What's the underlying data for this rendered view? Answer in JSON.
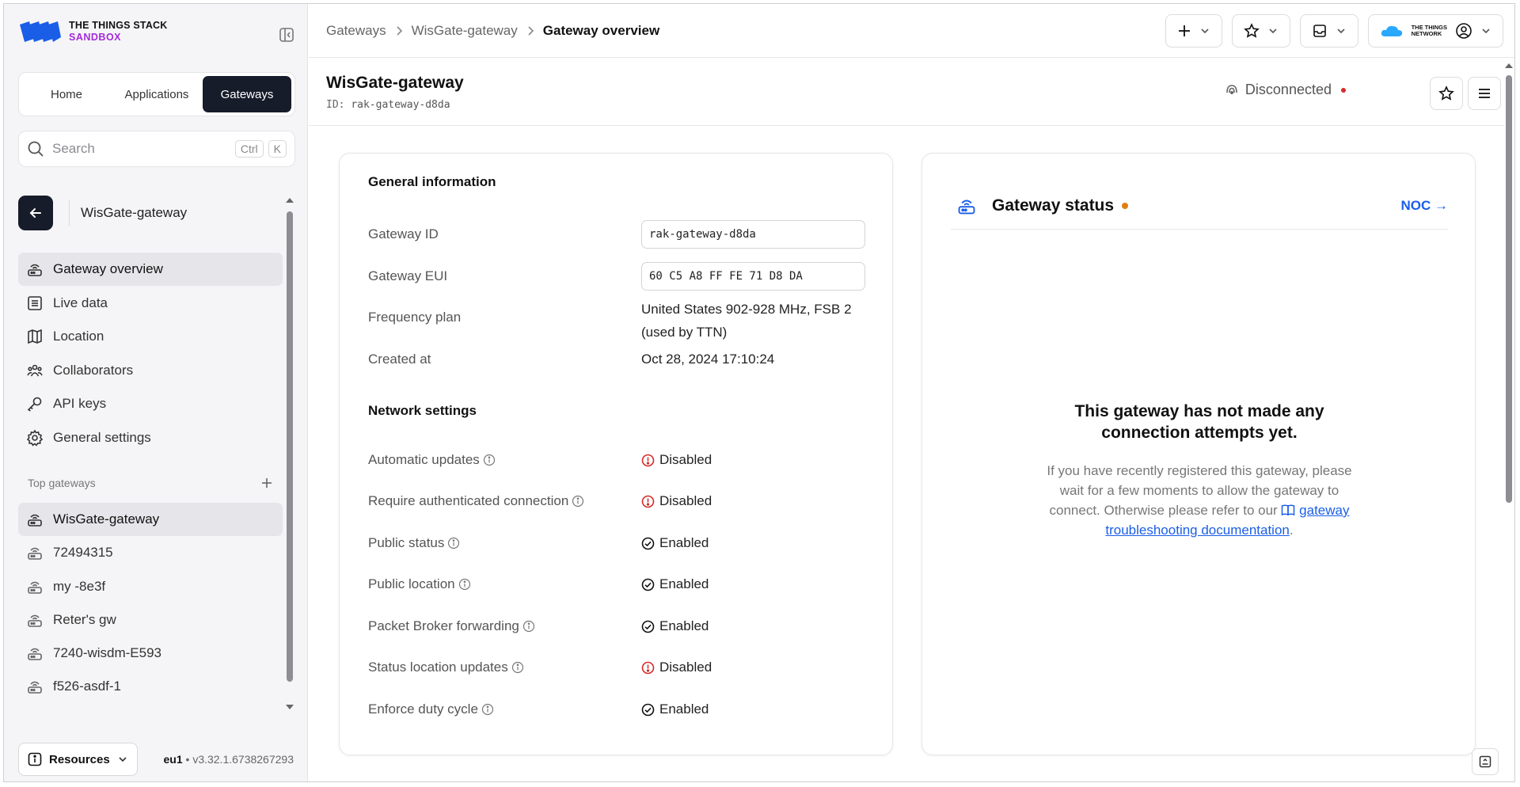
{
  "brand": {
    "line1": "THE THINGS STACK",
    "line2": "SANDBOX"
  },
  "tabs": [
    {
      "label": "Home"
    },
    {
      "label": "Applications"
    },
    {
      "label": "Gateways"
    }
  ],
  "search": {
    "placeholder": "Search",
    "key1": "Ctrl",
    "key2": "K"
  },
  "entity": {
    "title": "WisGate-gateway"
  },
  "nav": [
    {
      "label": "Gateway overview"
    },
    {
      "label": "Live data"
    },
    {
      "label": "Location"
    },
    {
      "label": "Collaborators"
    },
    {
      "label": "API keys"
    },
    {
      "label": "General settings"
    }
  ],
  "top_gateways": {
    "heading": "Top gateways",
    "items": [
      {
        "label": "WisGate-gateway"
      },
      {
        "label": "72494315"
      },
      {
        "label": "my -8e3f"
      },
      {
        "label": "Reter's gw"
      },
      {
        "label": "7240-wisdm-E593"
      },
      {
        "label": "f526-asdf-1"
      }
    ]
  },
  "footer": {
    "resources": "Resources",
    "region": "eu1",
    "version": "v3.32.1.6738267293"
  },
  "breadcrumbs": {
    "c1": "Gateways",
    "c2": "WisGate-gateway",
    "c3": "Gateway overview"
  },
  "header": {
    "ttn_line1": "THE THINGS",
    "ttn_line2": "NETWORK"
  },
  "page": {
    "title": "WisGate-gateway",
    "id_label": "ID:",
    "id_value": "rak-gateway-d8da",
    "connection": "Disconnected"
  },
  "general": {
    "title": "General information",
    "gateway_id_label": "Gateway ID",
    "gateway_id": "rak-gateway-d8da",
    "eui_label": "Gateway EUI",
    "eui": "60 C5 A8 FF FE 71 D8 DA",
    "freq_label": "Frequency plan",
    "freq_line1": "United States 902-928 MHz, FSB 2",
    "freq_line2": "(used by TTN)",
    "created_label": "Created at",
    "created": "Oct 28, 2024 17:10:24"
  },
  "network": {
    "title": "Network settings",
    "rows": [
      {
        "label": "Automatic updates",
        "value": "Disabled"
      },
      {
        "label": "Require authenticated connection",
        "value": "Disabled"
      },
      {
        "label": "Public status",
        "value": "Enabled"
      },
      {
        "label": "Public location",
        "value": "Enabled"
      },
      {
        "label": "Packet Broker forwarding",
        "value": "Enabled"
      },
      {
        "label": "Status location updates",
        "value": "Disabled"
      },
      {
        "label": "Enforce duty cycle",
        "value": "Enabled"
      }
    ]
  },
  "status": {
    "title": "Gateway status",
    "noc": "NOC →",
    "empty_line1": "This gateway has not made any",
    "empty_line2": "connection attempts yet.",
    "body_1": "If you have recently registered this gateway, please wait for a few moments to allow the gateway to connect. Otherwise please refer to our",
    "link": "gateway troubleshooting documentation",
    "body_2": "."
  },
  "colors": {
    "primary": "#171c2a",
    "link": "#1a5ee8",
    "disabled": "#d42c2c",
    "warning": "#e27d11",
    "brand_purple": "#a52bd8"
  }
}
